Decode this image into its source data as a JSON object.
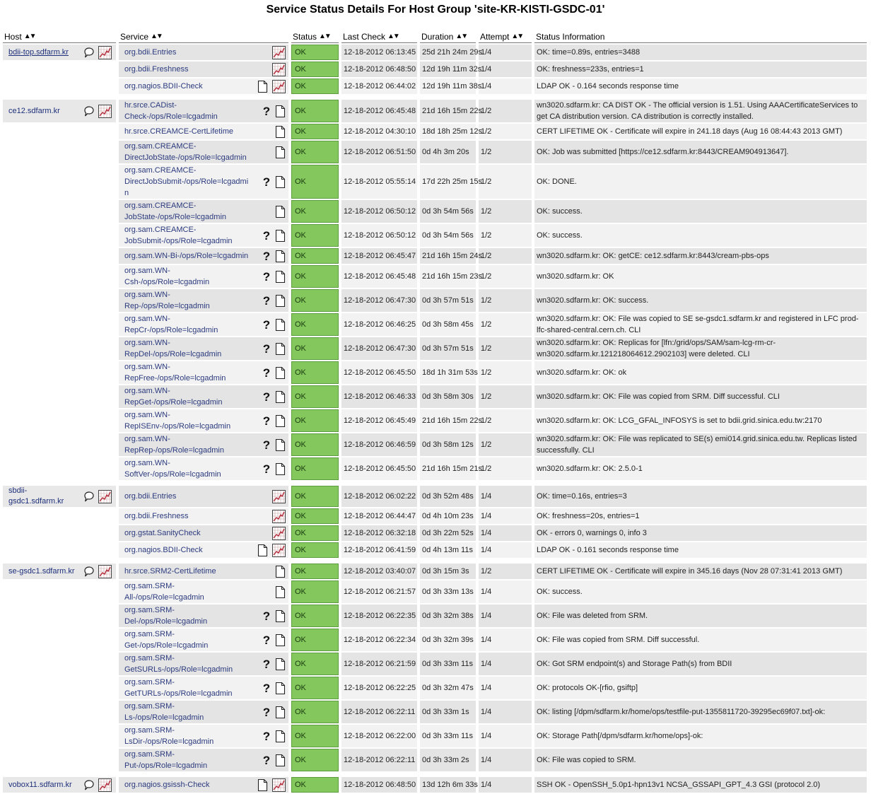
{
  "title": "Service Status Details For Host Group 'site-KR-KISTI-GSDC-01'",
  "columns": {
    "host": "Host",
    "service": "Service",
    "status": "Status",
    "last_check": "Last Check",
    "duration": "Duration",
    "attempt": "Attempt",
    "status_info": "Status Information"
  },
  "sort_icon": "sort-up-down-arrows",
  "colors": {
    "ok": "#84c85d",
    "link": "#2b3a7e"
  },
  "hosts": [
    {
      "name": "bdii-top.sdfarm.kr",
      "underlined": true,
      "services": [
        {
          "name": "org.bdii.Entries",
          "help": false,
          "notes": false,
          "graph": true,
          "status": "OK",
          "last_check": "12-18-2012 06:13:45",
          "duration": "25d 21h 24m 29s",
          "attempt": "1/4",
          "info": "OK: time=0.89s, entries=3488"
        },
        {
          "name": "org.bdii.Freshness",
          "help": false,
          "notes": false,
          "graph": true,
          "status": "OK",
          "last_check": "12-18-2012 06:48:50",
          "duration": "12d 19h 11m 32s",
          "attempt": "1/4",
          "info": "OK: freshness=233s, entries=1"
        },
        {
          "name": "org.nagios.BDII-Check",
          "help": false,
          "notes": true,
          "graph": true,
          "status": "OK",
          "last_check": "12-18-2012 06:44:02",
          "duration": "12d 19h 11m 38s",
          "attempt": "1/4",
          "info": "LDAP OK - 0.164 seconds response time"
        }
      ]
    },
    {
      "name": "ce12.sdfarm.kr",
      "underlined": false,
      "services": [
        {
          "name": "hr.srce.CADist-Check-/ops/Role=lcgadmin",
          "help": true,
          "notes": true,
          "graph": false,
          "status": "OK",
          "last_check": "12-18-2012 06:45:48",
          "duration": "21d 16h 15m 22s",
          "attempt": "1/2",
          "info": "wn3020.sdfarm.kr: CA DIST OK - The official version is 1.51. Using AAACertificateServices to get CA distribution version. CA distribution is correctly installed."
        },
        {
          "name": "hr.srce.CREAMCE-CertLifetime",
          "help": false,
          "notes": true,
          "graph": false,
          "status": "OK",
          "last_check": "12-18-2012 04:30:10",
          "duration": "18d 18h 25m 12s",
          "attempt": "1/2",
          "info": "CERT LIFETIME OK - Certificate will expire in 241.18 days (Aug 16 08:44:43 2013 GMT)"
        },
        {
          "name": "org.sam.CREAMCE-DirectJobState-/ops/Role=lcgadmin",
          "help": false,
          "notes": true,
          "graph": false,
          "status": "OK",
          "last_check": "12-18-2012 06:51:50",
          "duration": "0d 4h 3m 20s",
          "attempt": "1/2",
          "info": "OK: Job was submitted [https://ce12.sdfarm.kr:8443/CREAM904913647]."
        },
        {
          "name": "org.sam.CREAMCE-DirectJobSubmit-/ops/Role=lcgadmin",
          "help": true,
          "notes": true,
          "graph": false,
          "status": "OK",
          "last_check": "12-18-2012 05:55:14",
          "duration": "17d 22h 25m 15s",
          "attempt": "1/2",
          "info": "OK: DONE."
        },
        {
          "name": "org.sam.CREAMCE-JobState-/ops/Role=lcgadmin",
          "help": false,
          "notes": true,
          "graph": false,
          "status": "OK",
          "last_check": "12-18-2012 06:50:12",
          "duration": "0d 3h 54m 56s",
          "attempt": "1/2",
          "info": "OK: success."
        },
        {
          "name": "org.sam.CREAMCE-JobSubmit-/ops/Role=lcgadmin",
          "help": true,
          "notes": true,
          "graph": false,
          "status": "OK",
          "last_check": "12-18-2012 06:50:12",
          "duration": "0d 3h 54m 56s",
          "attempt": "1/2",
          "info": "OK: success."
        },
        {
          "name": "org.sam.WN-Bi-/ops/Role=lcgadmin",
          "help": true,
          "notes": true,
          "graph": false,
          "status": "OK",
          "last_check": "12-18-2012 06:45:47",
          "duration": "21d 16h 15m 24s",
          "attempt": "1/2",
          "info": "wn3020.sdfarm.kr: OK: getCE: ce12.sdfarm.kr:8443/cream-pbs-ops"
        },
        {
          "name": "org.sam.WN-Csh-/ops/Role=lcgadmin",
          "help": true,
          "notes": true,
          "graph": false,
          "status": "OK",
          "last_check": "12-18-2012 06:45:48",
          "duration": "21d 16h 15m 23s",
          "attempt": "1/2",
          "info": "wn3020.sdfarm.kr: OK"
        },
        {
          "name": "org.sam.WN-Rep-/ops/Role=lcgadmin",
          "help": true,
          "notes": true,
          "graph": false,
          "status": "OK",
          "last_check": "12-18-2012 06:47:30",
          "duration": "0d 3h 57m 51s",
          "attempt": "1/2",
          "info": "wn3020.sdfarm.kr: OK: success."
        },
        {
          "name": "org.sam.WN-RepCr-/ops/Role=lcgadmin",
          "help": true,
          "notes": true,
          "graph": false,
          "status": "OK",
          "last_check": "12-18-2012 06:46:25",
          "duration": "0d 3h 58m 45s",
          "attempt": "1/2",
          "info": "wn3020.sdfarm.kr: OK: File was copied to SE se-gsdc1.sdfarm.kr and registered in LFC prod-lfc-shared-central.cern.ch. CLI"
        },
        {
          "name": "org.sam.WN-RepDel-/ops/Role=lcgadmin",
          "help": true,
          "notes": true,
          "graph": false,
          "status": "OK",
          "last_check": "12-18-2012 06:47:30",
          "duration": "0d 3h 57m 51s",
          "attempt": "1/2",
          "info": "wn3020.sdfarm.kr: OK: Replicas for [lfn:/grid/ops/SAM/sam-lcg-rm-cr-wn3020.sdfarm.kr.121218064612.2902103] were deleted. CLI"
        },
        {
          "name": "org.sam.WN-RepFree-/ops/Role=lcgadmin",
          "help": true,
          "notes": true,
          "graph": false,
          "status": "OK",
          "last_check": "12-18-2012 06:45:50",
          "duration": "18d 1h 31m 53s",
          "attempt": "1/2",
          "info": "wn3020.sdfarm.kr: OK: ok"
        },
        {
          "name": "org.sam.WN-RepGet-/ops/Role=lcgadmin",
          "help": true,
          "notes": true,
          "graph": false,
          "status": "OK",
          "last_check": "12-18-2012 06:46:33",
          "duration": "0d 3h 58m 30s",
          "attempt": "1/2",
          "info": "wn3020.sdfarm.kr: OK: File was copied from SRM. Diff successful. CLI"
        },
        {
          "name": "org.sam.WN-RepISEnv-/ops/Role=lcgadmin",
          "help": true,
          "notes": true,
          "graph": false,
          "status": "OK",
          "last_check": "12-18-2012 06:45:49",
          "duration": "21d 16h 15m 22s",
          "attempt": "1/2",
          "info": "wn3020.sdfarm.kr: OK: LCG_GFAL_INFOSYS is set to bdii.grid.sinica.edu.tw:2170"
        },
        {
          "name": "org.sam.WN-RepRep-/ops/Role=lcgadmin",
          "help": true,
          "notes": true,
          "graph": false,
          "status": "OK",
          "last_check": "12-18-2012 06:46:59",
          "duration": "0d 3h 58m 12s",
          "attempt": "1/2",
          "info": "wn3020.sdfarm.kr: OK: File was replicated to SE(s) emi014.grid.sinica.edu.tw. Replicas listed successfully. CLI"
        },
        {
          "name": "org.sam.WN-SoftVer-/ops/Role=lcgadmin",
          "help": true,
          "notes": true,
          "graph": false,
          "status": "OK",
          "last_check": "12-18-2012 06:45:50",
          "duration": "21d 16h 15m 21s",
          "attempt": "1/2",
          "info": "wn3020.sdfarm.kr: OK: 2.5.0-1"
        }
      ]
    },
    {
      "name": "sbdii-gsdc1.sdfarm.kr",
      "underlined": false,
      "services": [
        {
          "name": "org.bdii.Entries",
          "help": false,
          "notes": false,
          "graph": true,
          "status": "OK",
          "last_check": "12-18-2012 06:02:22",
          "duration": "0d 3h 52m 48s",
          "attempt": "1/4",
          "info": "OK: time=0.16s, entries=3"
        },
        {
          "name": "org.bdii.Freshness",
          "help": false,
          "notes": false,
          "graph": true,
          "status": "OK",
          "last_check": "12-18-2012 06:44:47",
          "duration": "0d 4h 10m 23s",
          "attempt": "1/4",
          "info": "OK: freshness=20s, entries=1"
        },
        {
          "name": "org.gstat.SanityCheck",
          "help": false,
          "notes": false,
          "graph": true,
          "status": "OK",
          "last_check": "12-18-2012 06:32:18",
          "duration": "0d 3h 22m 52s",
          "attempt": "1/4",
          "info": "OK - errors 0, warnings 0, info 3"
        },
        {
          "name": "org.nagios.BDII-Check",
          "help": false,
          "notes": true,
          "graph": true,
          "status": "OK",
          "last_check": "12-18-2012 06:41:59",
          "duration": "0d 4h 13m 11s",
          "attempt": "1/4",
          "info": "LDAP OK - 0.161 seconds response time"
        }
      ]
    },
    {
      "name": "se-gsdc1.sdfarm.kr",
      "underlined": false,
      "services": [
        {
          "name": "hr.srce.SRM2-CertLifetime",
          "help": false,
          "notes": true,
          "graph": false,
          "status": "OK",
          "last_check": "12-18-2012 03:40:07",
          "duration": "0d 3h 15m 3s",
          "attempt": "1/2",
          "info": "CERT LIFETIME OK - Certificate will expire in 345.16 days (Nov 28 07:31:41 2013 GMT)"
        },
        {
          "name": "org.sam.SRM-All-/ops/Role=lcgadmin",
          "help": false,
          "notes": true,
          "graph": false,
          "status": "OK",
          "last_check": "12-18-2012 06:21:57",
          "duration": "0d 3h 33m 13s",
          "attempt": "1/4",
          "info": "OK: success."
        },
        {
          "name": "org.sam.SRM-Del-/ops/Role=lcgadmin",
          "help": true,
          "notes": true,
          "graph": false,
          "status": "OK",
          "last_check": "12-18-2012 06:22:35",
          "duration": "0d 3h 32m 38s",
          "attempt": "1/4",
          "info": "OK: File was deleted from SRM."
        },
        {
          "name": "org.sam.SRM-Get-/ops/Role=lcgadmin",
          "help": true,
          "notes": true,
          "graph": false,
          "status": "OK",
          "last_check": "12-18-2012 06:22:34",
          "duration": "0d 3h 32m 39s",
          "attempt": "1/4",
          "info": "OK: File was copied from SRM. Diff successful."
        },
        {
          "name": "org.sam.SRM-GetSURLs-/ops/Role=lcgadmin",
          "help": true,
          "notes": true,
          "graph": false,
          "status": "OK",
          "last_check": "12-18-2012 06:21:59",
          "duration": "0d 3h 33m 11s",
          "attempt": "1/4",
          "info": "OK: Got SRM endpoint(s) and Storage Path(s) from BDII"
        },
        {
          "name": "org.sam.SRM-GetTURLs-/ops/Role=lcgadmin",
          "help": true,
          "notes": true,
          "graph": false,
          "status": "OK",
          "last_check": "12-18-2012 06:22:25",
          "duration": "0d 3h 32m 47s",
          "attempt": "1/4",
          "info": "OK: protocols OK-[rfio, gsiftp]"
        },
        {
          "name": "org.sam.SRM-Ls-/ops/Role=lcgadmin",
          "help": true,
          "notes": true,
          "graph": false,
          "status": "OK",
          "last_check": "12-18-2012 06:22:11",
          "duration": "0d 3h 33m 1s",
          "attempt": "1/4",
          "info": "OK: listing [/dpm/sdfarm.kr/home/ops/testfile-put-1355811720-39295ec69f07.txt]-ok:"
        },
        {
          "name": "org.sam.SRM-LsDir-/ops/Role=lcgadmin",
          "help": true,
          "notes": true,
          "graph": false,
          "status": "OK",
          "last_check": "12-18-2012 06:22:00",
          "duration": "0d 3h 33m 11s",
          "attempt": "1/4",
          "info": "OK: Storage Path[/dpm/sdfarm.kr/home/ops]-ok:"
        },
        {
          "name": "org.sam.SRM-Put-/ops/Role=lcgadmin",
          "help": true,
          "notes": true,
          "graph": false,
          "status": "OK",
          "last_check": "12-18-2012 06:22:11",
          "duration": "0d 3h 33m 2s",
          "attempt": "1/4",
          "info": "OK: File was copied to SRM."
        }
      ]
    },
    {
      "name": "vobox11.sdfarm.kr",
      "underlined": false,
      "services": [
        {
          "name": "org.nagios.gsissh-Check",
          "help": false,
          "notes": true,
          "graph": true,
          "status": "OK",
          "last_check": "12-18-2012 06:48:50",
          "duration": "13d 12h 6m 33s",
          "attempt": "1/4",
          "info": "SSH OK - OpenSSH_5.0p1-hpn13v1 NCSA_GSSAPI_GPT_4.3 GSI (protocol 2.0)"
        }
      ]
    }
  ]
}
